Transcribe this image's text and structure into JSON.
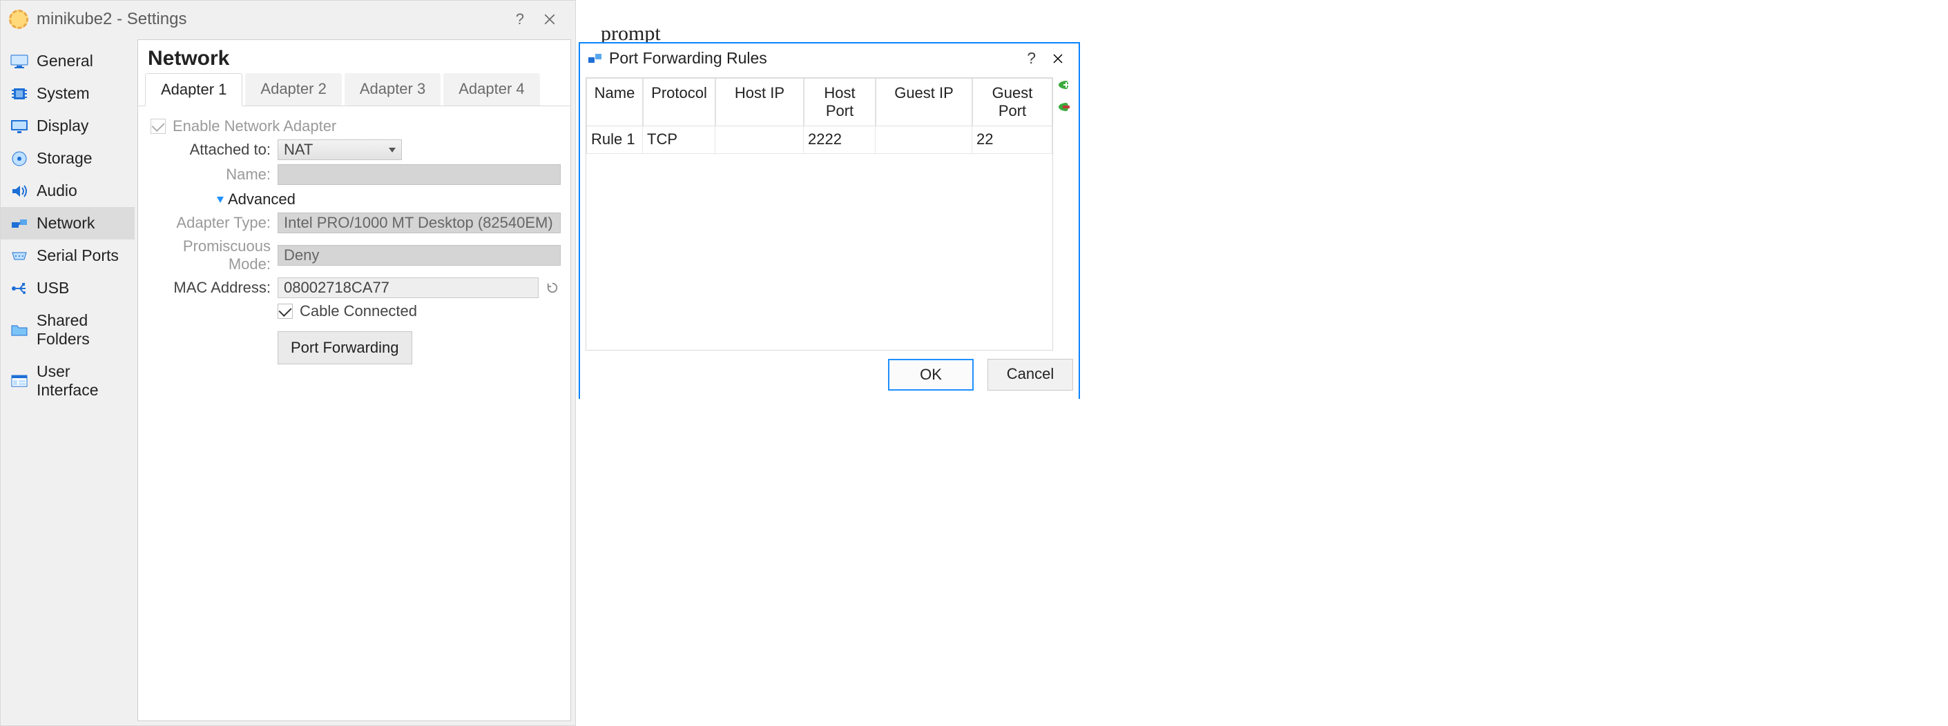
{
  "settings": {
    "title": "minikube2 - Settings",
    "sidebar": {
      "items": [
        {
          "label": "General",
          "icon": "monitor-icon"
        },
        {
          "label": "System",
          "icon": "chip-icon"
        },
        {
          "label": "Display",
          "icon": "display-icon"
        },
        {
          "label": "Storage",
          "icon": "disk-icon"
        },
        {
          "label": "Audio",
          "icon": "audio-icon"
        },
        {
          "label": "Network",
          "icon": "network-icon",
          "selected": true
        },
        {
          "label": "Serial Ports",
          "icon": "serial-icon"
        },
        {
          "label": "USB",
          "icon": "usb-icon"
        },
        {
          "label": "Shared Folders",
          "icon": "folder-icon"
        },
        {
          "label": "User Interface",
          "icon": "ui-icon"
        }
      ]
    },
    "content": {
      "heading": "Network",
      "tabs": [
        {
          "label": "Adapter 1",
          "active": true
        },
        {
          "label": "Adapter 2"
        },
        {
          "label": "Adapter 3"
        },
        {
          "label": "Adapter 4"
        }
      ],
      "enable_label": "Enable Network Adapter",
      "enable_checked": true,
      "attached_to_label": "Attached to:",
      "attached_to_value": "NAT",
      "name_label": "Name:",
      "name_value": "",
      "advanced_label": "Advanced",
      "adapter_type_label": "Adapter Type:",
      "adapter_type_value": "Intel PRO/1000 MT Desktop (82540EM)",
      "promiscuous_label": "Promiscuous Mode:",
      "promiscuous_value": "Deny",
      "mac_label": "MAC Address:",
      "mac_value": "08002718CA77",
      "cable_label": "Cable Connected",
      "cable_checked": true,
      "port_forwarding_button": "Port Forwarding"
    }
  },
  "peek": "prompt",
  "pf": {
    "title": "Port Forwarding Rules",
    "columns": {
      "name": "Name",
      "protocol": "Protocol",
      "host_ip": "Host IP",
      "host_port": "Host Port",
      "guest_ip": "Guest IP",
      "guest_port": "Guest Port"
    },
    "rows": [
      {
        "name": "Rule 1",
        "protocol": "TCP",
        "host_ip": "",
        "host_port": "2222",
        "guest_ip": "",
        "guest_port": "22"
      }
    ],
    "buttons": {
      "ok": "OK",
      "cancel": "Cancel"
    }
  }
}
